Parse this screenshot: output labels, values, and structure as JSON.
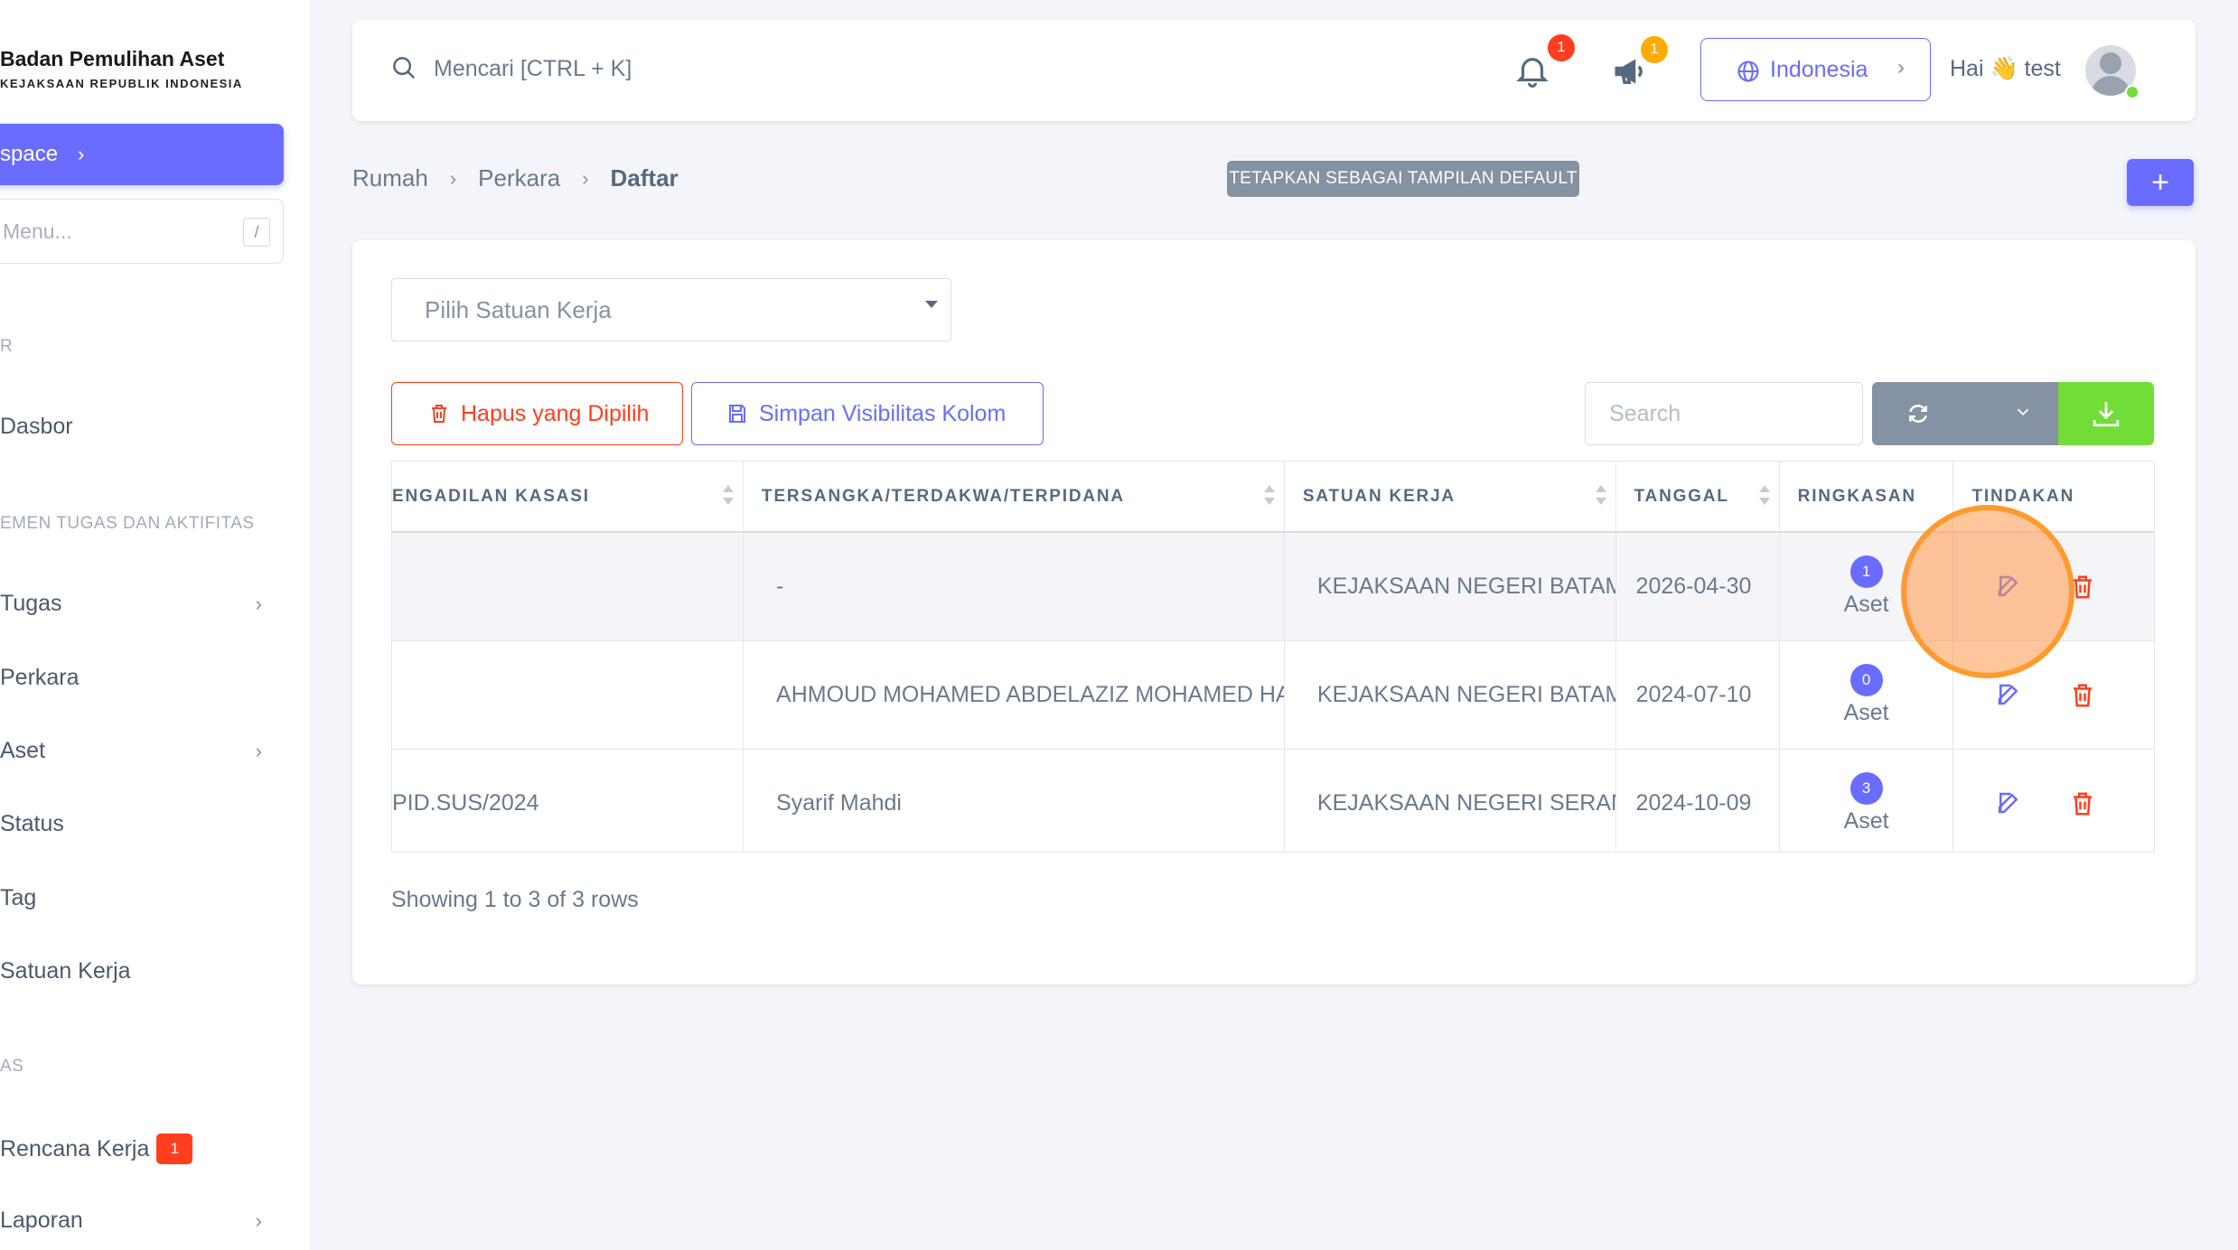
{
  "sidebar": {
    "brand_title": "Badan Pemulihan Aset",
    "brand_subtitle": "KEJAKSAAN REPUBLIK INDONESIA",
    "workspace_label": "space",
    "menu_search_placeholder": "Menu...",
    "menu_search_shortcut": "/",
    "section_1": "R",
    "section_2": "EMEN TUGAS DAN AKTIFITAS",
    "section_3": "AS",
    "items": [
      {
        "label": "Dasbor"
      },
      {
        "label": "Tugas"
      },
      {
        "label": "Perkara"
      },
      {
        "label": "Aset"
      },
      {
        "label": "Status"
      },
      {
        "label": "Tag"
      },
      {
        "label": "Satuan Kerja"
      },
      {
        "label": "Rencana Kerja",
        "badge": "1"
      },
      {
        "label": "Laporan"
      }
    ]
  },
  "navbar": {
    "search_placeholder": "Mencari [CTRL + K]",
    "notifications_count": "1",
    "announcements_count": "1",
    "language": "Indonesia",
    "greeting": "Hai 👋 test"
  },
  "breadcrumb": {
    "items": [
      "Rumah",
      "Perkara",
      "Daftar"
    ]
  },
  "set_default_label": "TETAPKAN SEBAGAI TAMPILAN DEFAULT",
  "add_button": "+",
  "filter": {
    "work_unit_placeholder": "Pilih Satuan Kerja"
  },
  "toolbar": {
    "delete_selected": "Hapus yang Dipilih",
    "save_visibility": "Simpan Visibilitas Kolom",
    "search_placeholder": "Search"
  },
  "table": {
    "columns": [
      "ENGADILAN KASASI",
      "TERSANGKA/TERDAKWA/TERPIDANA",
      "SATUAN KERJA",
      "TANGGAL",
      "RINGKASAN",
      "TINDAKAN"
    ],
    "rows": [
      {
        "kasasi": "",
        "tersangka": "-",
        "satuan_kerja": "KEJAKSAAN NEGERI BATAM",
        "tanggal": "2026-04-30",
        "aset_count": "1",
        "aset_label": "Aset"
      },
      {
        "kasasi": "",
        "tersangka": "AHMOUD MOHAMED ABDELAZIZ MOHAMED HATIBA",
        "satuan_kerja": "KEJAKSAAN NEGERI BATAM",
        "tanggal": "2024-07-10",
        "aset_count": "0",
        "aset_label": "Aset"
      },
      {
        "kasasi": "PID.SUS/2024",
        "tersangka": "Syarif Mahdi",
        "satuan_kerja": "KEJAKSAAN NEGERI SERANG",
        "tanggal": "2024-10-09",
        "aset_count": "3",
        "aset_label": "Aset"
      }
    ],
    "footer": "Showing 1 to 3 of 3 rows"
  },
  "colors": {
    "primary": "#696cff",
    "danger": "#ff3e1d",
    "success": "#71dd37",
    "secondary": "#8592a3",
    "highlight": "#ff9a2e"
  }
}
